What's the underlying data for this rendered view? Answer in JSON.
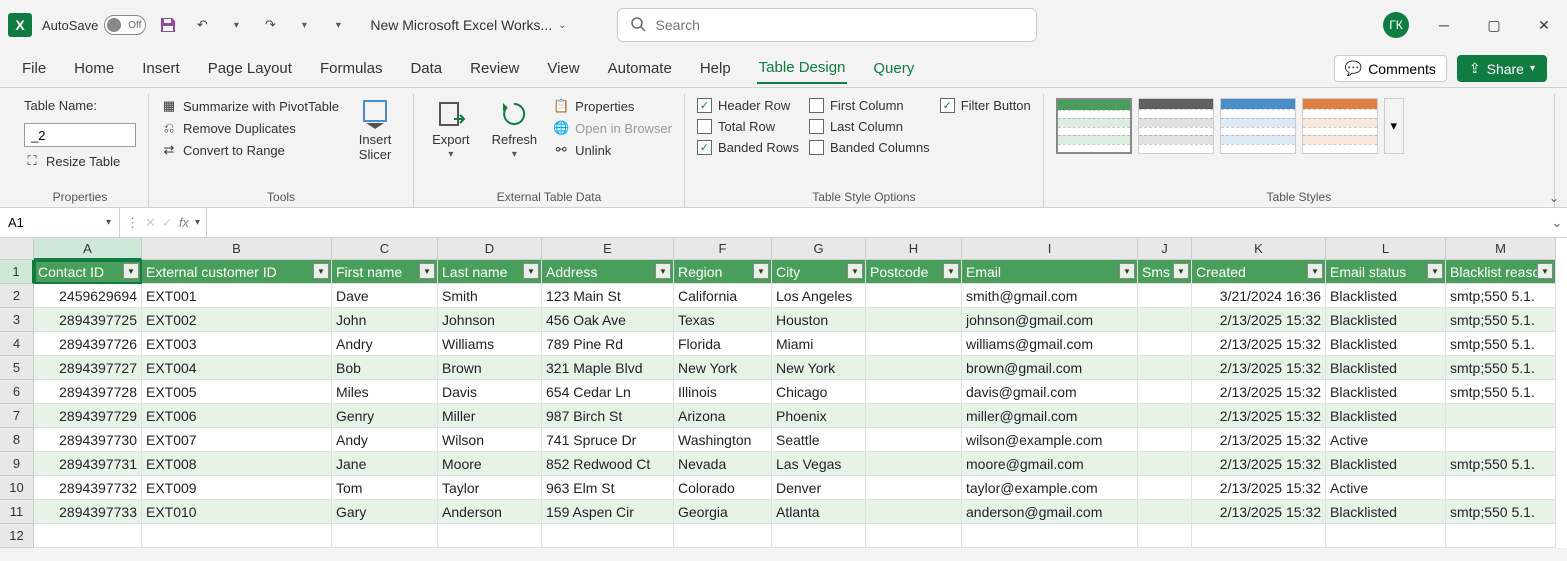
{
  "titlebar": {
    "autosave_label": "AutoSave",
    "autosave_state": "Off",
    "doc_title": "New Microsoft Excel Works...",
    "search_placeholder": "Search",
    "user_initials": "ГК"
  },
  "tabs": [
    "File",
    "Home",
    "Insert",
    "Page Layout",
    "Formulas",
    "Data",
    "Review",
    "View",
    "Automate",
    "Help",
    "Table Design",
    "Query"
  ],
  "active_tab": "Table Design",
  "tab_buttons": {
    "comments": "Comments",
    "share": "Share"
  },
  "ribbon": {
    "properties": {
      "table_name_label": "Table Name:",
      "table_name_value": "_2",
      "resize": "Resize Table",
      "group_label": "Properties"
    },
    "tools": {
      "pivot": "Summarize with PivotTable",
      "dup": "Remove Duplicates",
      "range": "Convert to Range",
      "slicer": "Insert Slicer",
      "group_label": "Tools"
    },
    "external": {
      "export": "Export",
      "refresh": "Refresh",
      "props": "Properties",
      "browser": "Open in Browser",
      "unlink": "Unlink",
      "group_label": "External Table Data"
    },
    "options": {
      "header_row": "Header Row",
      "total_row": "Total Row",
      "banded_rows": "Banded Rows",
      "first_col": "First Column",
      "last_col": "Last Column",
      "banded_cols": "Banded Columns",
      "filter_btn": "Filter Button",
      "group_label": "Table Style Options"
    },
    "styles": {
      "group_label": "Table Styles"
    }
  },
  "formula_bar": {
    "namebox": "A1",
    "fx": ""
  },
  "columns_letters": [
    "A",
    "B",
    "C",
    "D",
    "E",
    "F",
    "G",
    "H",
    "I",
    "J",
    "K",
    "L",
    "M"
  ],
  "headers": [
    "Contact ID",
    "External customer ID",
    "First name",
    "Last name",
    "Address",
    "Region",
    "City",
    "Postcode",
    "Email",
    "Sms",
    "Created",
    "Email status",
    "Blacklist reaso"
  ],
  "rows": [
    {
      "id": "2459629694",
      "ext": "EXT001",
      "fn": "Dave",
      "ln": "Smith",
      "addr": "123 Main St",
      "region": "California",
      "city": "Los Angeles",
      "pc": "",
      "email": "smith@gmail.com",
      "sms": "",
      "created": "3/21/2024 16:36",
      "status": "Blacklisted",
      "reason": "smtp;550 5.1."
    },
    {
      "id": "2894397725",
      "ext": "EXT002",
      "fn": "John",
      "ln": "Johnson",
      "addr": "456 Oak Ave",
      "region": "Texas",
      "city": "Houston",
      "pc": "",
      "email": "johnson@gmail.com",
      "sms": "",
      "created": "2/13/2025 15:32",
      "status": "Blacklisted",
      "reason": "smtp;550 5.1."
    },
    {
      "id": "2894397726",
      "ext": "EXT003",
      "fn": "Andry",
      "ln": "Williams",
      "addr": "789 Pine Rd",
      "region": "Florida",
      "city": "Miami",
      "pc": "",
      "email": "williams@gmail.com",
      "sms": "",
      "created": "2/13/2025 15:32",
      "status": "Blacklisted",
      "reason": "smtp;550 5.1."
    },
    {
      "id": "2894397727",
      "ext": "EXT004",
      "fn": "Bob",
      "ln": "Brown",
      "addr": "321 Maple Blvd",
      "region": "New York",
      "city": "New York",
      "pc": "",
      "email": "brown@gmail.com",
      "sms": "",
      "created": "2/13/2025 15:32",
      "status": "Blacklisted",
      "reason": "smtp;550 5.1."
    },
    {
      "id": "2894397728",
      "ext": "EXT005",
      "fn": "Miles",
      "ln": "Davis",
      "addr": "654 Cedar Ln",
      "region": "Illinois",
      "city": "Chicago",
      "pc": "",
      "email": "davis@gmail.com",
      "sms": "",
      "created": "2/13/2025 15:32",
      "status": "Blacklisted",
      "reason": "smtp;550 5.1."
    },
    {
      "id": "2894397729",
      "ext": "EXT006",
      "fn": "Genry",
      "ln": "Miller",
      "addr": "987 Birch St",
      "region": "Arizona",
      "city": "Phoenix",
      "pc": "",
      "email": "miller@gmail.com",
      "sms": "",
      "created": "2/13/2025 15:32",
      "status": "Blacklisted",
      "reason": ""
    },
    {
      "id": "2894397730",
      "ext": "EXT007",
      "fn": "Andy",
      "ln": "Wilson",
      "addr": "741 Spruce Dr",
      "region": "Washington",
      "city": "Seattle",
      "pc": "",
      "email": "wilson@example.com",
      "sms": "",
      "created": "2/13/2025 15:32",
      "status": "Active",
      "reason": ""
    },
    {
      "id": "2894397731",
      "ext": "EXT008",
      "fn": "Jane",
      "ln": "Moore",
      "addr": "852 Redwood Ct",
      "region": "Nevada",
      "city": "Las Vegas",
      "pc": "",
      "email": "moore@gmail.com",
      "sms": "",
      "created": "2/13/2025 15:32",
      "status": "Blacklisted",
      "reason": "smtp;550 5.1."
    },
    {
      "id": "2894397732",
      "ext": "EXT009",
      "fn": "Tom",
      "ln": "Taylor",
      "addr": "963 Elm St",
      "region": "Colorado",
      "city": "Denver",
      "pc": "",
      "email": "taylor@example.com",
      "sms": "",
      "created": "2/13/2025 15:32",
      "status": "Active",
      "reason": ""
    },
    {
      "id": "2894397733",
      "ext": "EXT010",
      "fn": "Gary",
      "ln": "Anderson",
      "addr": "159 Aspen Cir",
      "region": "Georgia",
      "city": "Atlanta",
      "pc": "",
      "email": "anderson@gmail.com",
      "sms": "",
      "created": "2/13/2025 15:32",
      "status": "Blacklisted",
      "reason": "smtp;550 5.1."
    }
  ],
  "style_colors": [
    "#4a9e5c",
    "#606060",
    "#4a8ec9",
    "#e08040"
  ]
}
